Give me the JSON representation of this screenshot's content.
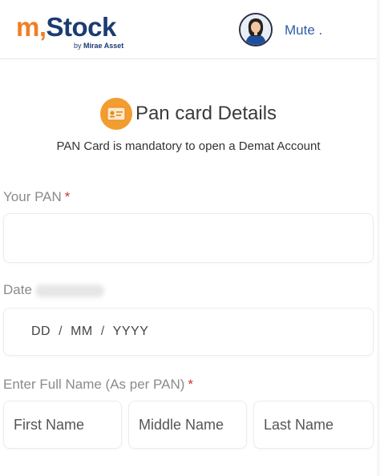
{
  "header": {
    "logo_m": "m",
    "logo_comma": ",",
    "logo_stock": "Stock",
    "logo_by": "by",
    "logo_brand": "Mirae Asset",
    "user_name": "Mute ."
  },
  "section": {
    "icon": "id-card-icon",
    "title": "Pan card Details",
    "subtitle": "PAN Card is mandatory to open a Demat Account"
  },
  "form": {
    "pan": {
      "label": "Your PAN",
      "required_mark": "*",
      "value": ""
    },
    "dob": {
      "label": "Date",
      "day_placeholder": "DD",
      "month_placeholder": "MM",
      "year_placeholder": "YYYY",
      "separator": "/"
    },
    "full_name": {
      "label": "Enter Full Name (As per PAN)",
      "required_mark": "*",
      "first_placeholder": "First Name",
      "middle_placeholder": "Middle Name",
      "last_placeholder": "Last Name"
    }
  },
  "colors": {
    "brand_orange": "#f07f22",
    "brand_navy": "#1c3b72",
    "link_blue": "#2d5fa8",
    "required_red": "#d0342c"
  }
}
